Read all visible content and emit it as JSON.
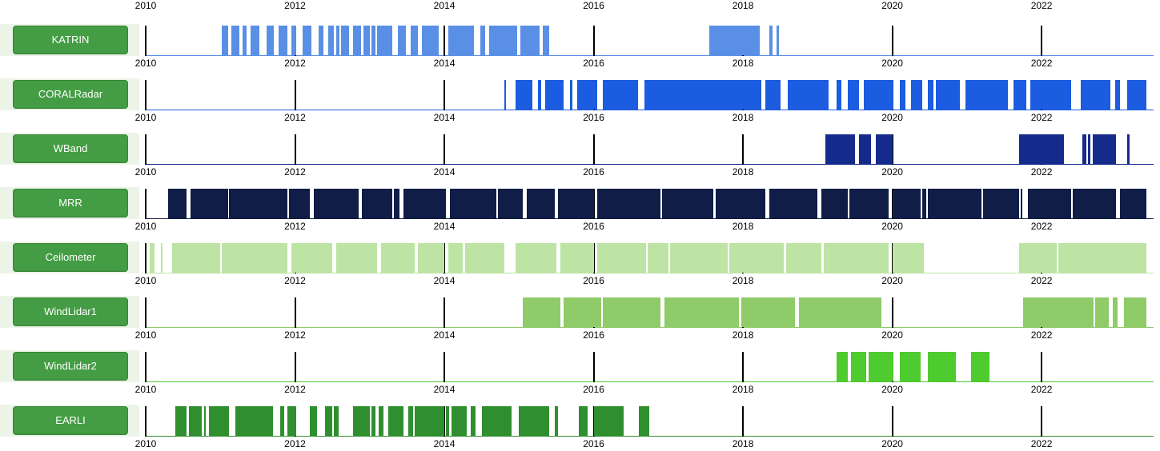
{
  "range": {
    "start": 2010,
    "end_exclusive": 2023.5
  },
  "ticks": [
    2010,
    2012,
    2014,
    2016,
    2018,
    2020,
    2022
  ],
  "chart_data": {
    "type": "bar",
    "xlabel": "",
    "ylabel": "",
    "title": "",
    "xlim": [
      2010,
      2023.5
    ],
    "series": [
      {
        "name": "KATRIN",
        "color": "#5A8FE6",
        "segments": [
          [
            2011.02,
            2011.1
          ],
          [
            2011.15,
            2011.25
          ],
          [
            2011.3,
            2011.35
          ],
          [
            2011.4,
            2011.52
          ],
          [
            2011.62,
            2011.72
          ],
          [
            2011.78,
            2011.9
          ],
          [
            2011.95,
            2012.02
          ],
          [
            2012.1,
            2012.22
          ],
          [
            2012.32,
            2012.38
          ],
          [
            2012.45,
            2012.52
          ],
          [
            2012.55,
            2012.6
          ],
          [
            2012.62,
            2012.72
          ],
          [
            2012.78,
            2012.88
          ],
          [
            2012.92,
            2013.0
          ],
          [
            2013.02,
            2013.08
          ],
          [
            2013.1,
            2013.3
          ],
          [
            2013.38,
            2013.48
          ],
          [
            2013.55,
            2013.65
          ],
          [
            2013.7,
            2013.92
          ],
          [
            2014.05,
            2014.4
          ],
          [
            2014.48,
            2014.55
          ],
          [
            2014.6,
            2014.98
          ],
          [
            2015.02,
            2015.28
          ],
          [
            2015.32,
            2015.4
          ],
          [
            2017.55,
            2018.22
          ],
          [
            2018.35,
            2018.4
          ],
          [
            2018.45,
            2018.48
          ]
        ]
      },
      {
        "name": "CORALRadar",
        "color": "#1B5CE0",
        "segments": [
          [
            2014.8,
            2014.83
          ],
          [
            2014.95,
            2015.18
          ],
          [
            2015.25,
            2015.3
          ],
          [
            2015.35,
            2015.6
          ],
          [
            2015.68,
            2015.72
          ],
          [
            2015.78,
            2016.05
          ],
          [
            2016.12,
            2016.6
          ],
          [
            2016.68,
            2018.25
          ],
          [
            2018.3,
            2018.5
          ],
          [
            2018.6,
            2019.15
          ],
          [
            2019.25,
            2019.32
          ],
          [
            2019.4,
            2019.55
          ],
          [
            2019.62,
            2020.02
          ],
          [
            2020.1,
            2020.18
          ],
          [
            2020.25,
            2020.4
          ],
          [
            2020.48,
            2020.55
          ],
          [
            2020.58,
            2020.9
          ],
          [
            2020.98,
            2021.55
          ],
          [
            2021.62,
            2021.8
          ],
          [
            2021.85,
            2022.4
          ],
          [
            2022.52,
            2022.92
          ],
          [
            2022.98,
            2023.05
          ],
          [
            2023.15,
            2023.4
          ]
        ]
      },
      {
        "name": "WBand",
        "color": "#152B8C",
        "segments": [
          [
            2019.1,
            2019.5
          ],
          [
            2019.55,
            2019.72
          ],
          [
            2019.78,
            2020.0
          ],
          [
            2021.7,
            2022.3
          ],
          [
            2022.55,
            2022.6
          ],
          [
            2022.62,
            2022.65
          ],
          [
            2022.68,
            2023.0
          ],
          [
            2023.15,
            2023.18
          ]
        ]
      },
      {
        "name": "MRR",
        "color": "#101D46",
        "segments": [
          [
            2010.3,
            2010.55
          ],
          [
            2010.6,
            2011.1
          ],
          [
            2011.12,
            2011.9
          ],
          [
            2011.92,
            2012.2
          ],
          [
            2012.25,
            2012.85
          ],
          [
            2012.9,
            2013.3
          ],
          [
            2013.32,
            2013.4
          ],
          [
            2013.45,
            2014.02
          ],
          [
            2014.08,
            2014.7
          ],
          [
            2014.72,
            2015.05
          ],
          [
            2015.1,
            2015.48
          ],
          [
            2015.52,
            2016.0
          ],
          [
            2016.05,
            2016.9
          ],
          [
            2016.92,
            2017.6
          ],
          [
            2017.63,
            2018.3
          ],
          [
            2018.35,
            2019.0
          ],
          [
            2019.05,
            2019.4
          ],
          [
            2019.42,
            2019.95
          ],
          [
            2020.0,
            2020.38
          ],
          [
            2020.4,
            2020.45
          ],
          [
            2020.48,
            2021.2
          ],
          [
            2021.22,
            2021.7
          ],
          [
            2021.72,
            2021.74
          ],
          [
            2021.82,
            2022.4
          ],
          [
            2022.42,
            2023.0
          ],
          [
            2023.05,
            2023.4
          ]
        ]
      },
      {
        "name": "Ceilometer",
        "color": "#BDE4A4",
        "segments": [
          [
            2010.05,
            2010.12
          ],
          [
            2010.2,
            2010.22
          ],
          [
            2010.35,
            2011.0
          ],
          [
            2011.02,
            2011.9
          ],
          [
            2011.95,
            2012.5
          ],
          [
            2012.55,
            2013.1
          ],
          [
            2013.15,
            2013.6
          ],
          [
            2013.65,
            2014.0
          ],
          [
            2014.05,
            2014.25
          ],
          [
            2014.28,
            2014.8
          ],
          [
            2014.95,
            2015.5
          ],
          [
            2015.55,
            2016.0
          ],
          [
            2016.05,
            2016.7
          ],
          [
            2016.72,
            2017.0
          ],
          [
            2017.02,
            2017.8
          ],
          [
            2017.82,
            2018.55
          ],
          [
            2018.58,
            2019.05
          ],
          [
            2019.08,
            2019.95
          ],
          [
            2020.0,
            2020.42
          ],
          [
            2021.7,
            2022.2
          ],
          [
            2022.22,
            2023.4
          ]
        ]
      },
      {
        "name": "WindLidar1",
        "color": "#8FCB68",
        "segments": [
          [
            2015.05,
            2015.55
          ],
          [
            2015.6,
            2016.1
          ],
          [
            2016.12,
            2016.9
          ],
          [
            2016.95,
            2017.95
          ],
          [
            2017.98,
            2018.7
          ],
          [
            2018.75,
            2019.85
          ],
          [
            2021.75,
            2022.7
          ],
          [
            2022.72,
            2022.9
          ],
          [
            2022.95,
            2023.02
          ],
          [
            2023.1,
            2023.4
          ]
        ]
      },
      {
        "name": "WindLidar2",
        "color": "#4DCB2F",
        "segments": [
          [
            2019.25,
            2019.4
          ],
          [
            2019.45,
            2019.65
          ],
          [
            2019.68,
            2020.02
          ],
          [
            2020.1,
            2020.38
          ],
          [
            2020.48,
            2020.85
          ],
          [
            2021.05,
            2021.3
          ]
        ]
      },
      {
        "name": "EARLI",
        "color": "#2F8F2F",
        "segments": [
          [
            2010.4,
            2010.55
          ],
          [
            2010.58,
            2010.75
          ],
          [
            2010.78,
            2010.8
          ],
          [
            2010.85,
            2011.12
          ],
          [
            2011.2,
            2011.7
          ],
          [
            2011.8,
            2011.85
          ],
          [
            2011.9,
            2012.02
          ],
          [
            2012.2,
            2012.3
          ],
          [
            2012.4,
            2012.5
          ],
          [
            2012.52,
            2012.58
          ],
          [
            2012.78,
            2013.0
          ],
          [
            2013.02,
            2013.08
          ],
          [
            2013.12,
            2013.18
          ],
          [
            2013.25,
            2013.45
          ],
          [
            2013.52,
            2013.58
          ],
          [
            2013.6,
            2014.0
          ],
          [
            2014.02,
            2014.06
          ],
          [
            2014.1,
            2014.3
          ],
          [
            2014.35,
            2014.42
          ],
          [
            2014.5,
            2014.9
          ],
          [
            2015.0,
            2015.4
          ],
          [
            2015.48,
            2015.52
          ],
          [
            2015.8,
            2015.92
          ],
          [
            2016.0,
            2016.4
          ],
          [
            2016.6,
            2016.75
          ]
        ]
      }
    ]
  },
  "buttons": {
    "KATRIN": "KATRIN",
    "CORALRadar": "CORALRadar",
    "WBand": "WBand",
    "MRR": "MRR",
    "Ceilometer": "Ceilometer",
    "WindLidar1": "WindLidar1",
    "WindLidar2": "WindLidar2",
    "EARLI": "EARLI"
  }
}
